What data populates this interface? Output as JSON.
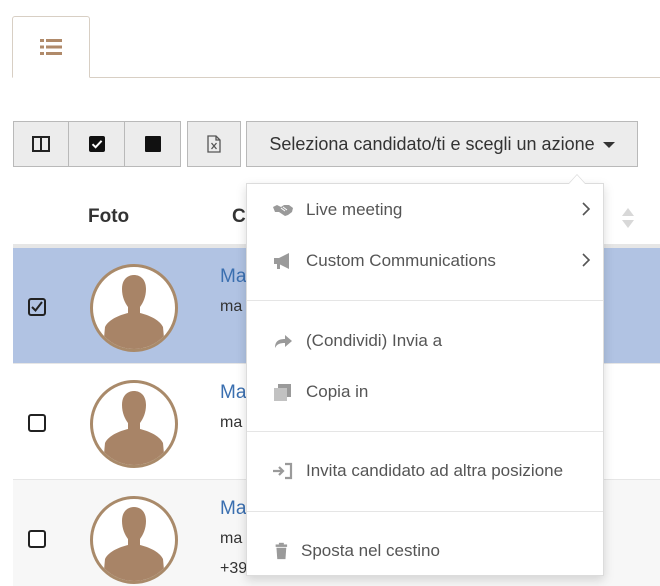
{
  "toolbar": {
    "action_label": "Seleziona candidato/ti e scegli un azione"
  },
  "table": {
    "col_foto": "Foto",
    "col_c": "C",
    "rows": [
      {
        "name": "Ma",
        "mail": "ma",
        "phone": ""
      },
      {
        "name": "Ma",
        "mail": "ma",
        "phone": ""
      },
      {
        "name": "Ma",
        "mail": "ma",
        "phone": "+39"
      }
    ]
  },
  "menu": {
    "items": [
      {
        "label": "Live meeting",
        "icon": "handshake-icon"
      },
      {
        "label": "Custom Communications",
        "icon": "megaphone-icon"
      },
      {
        "label": "(Condividi) Invia a",
        "icon": "share-icon"
      },
      {
        "label": "Copia in",
        "icon": "copy-icon"
      },
      {
        "label": "Invita candidato ad altra posizione",
        "icon": "sign-in-icon"
      },
      {
        "label": "Sposta nel cestino",
        "icon": "trash-icon"
      }
    ]
  },
  "colors": {
    "selected_row": "#b1c3e3",
    "link": "#3a6fb0",
    "avatar_border": "#a98a6a"
  }
}
